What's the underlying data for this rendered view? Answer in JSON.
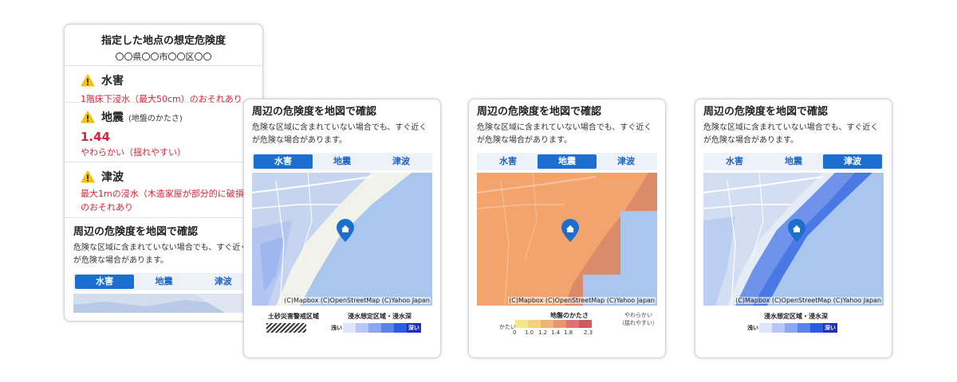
{
  "main_card": {
    "title": "指定した地点の想定危険度",
    "location": "〇〇県〇〇市〇〇区〇〇",
    "hazards": {
      "water": {
        "name": "水害",
        "text": "1階床下浸水（最大50cm）のおそれあり"
      },
      "quake": {
        "name": "地震",
        "sub": "(地盤のかたさ)",
        "value": "1.44",
        "text": "やわらかい（揺れやすい）"
      },
      "tsunami": {
        "name": "津波",
        "text": "最大1mの浸水（木造家屋が部分的に破損）のおそれあり"
      }
    }
  },
  "map_section": {
    "title": "周辺の危険度を地図で確認",
    "description": "危険な区域に含まれていない場合でも、すぐ近くが危険な場合があります。",
    "tabs": [
      "水害",
      "地震",
      "津波"
    ],
    "attribution": "(C)Mapbox (C)OpenStreetMap (C)Yahoo Japan"
  },
  "legend_flood": {
    "landslide_label": "土砂災害警戒区域",
    "depth_title": "浸水想定区域・浸水深",
    "shallow": "浅い",
    "deep": "深い",
    "colors": [
      "#dfe6fb",
      "#b7c8f8",
      "#8aa8f2",
      "#5a82ea",
      "#2c5be0",
      "#1b2fc0"
    ]
  },
  "legend_quake": {
    "title": "地盤のかたさ",
    "hard": "かたい",
    "soft": "やわらかい",
    "soft_note": "（揺れやすい）",
    "ticks": [
      "0",
      "1.0",
      "1.2",
      "1.4",
      "1.8",
      "2.3"
    ],
    "colors": [
      "#f5e88a",
      "#f2d27d",
      "#eeb476",
      "#e9966f",
      "#dd7472",
      "#cf5963"
    ]
  },
  "legend_tsunami": {
    "depth_title": "浸水想定区域・浸水深",
    "shallow": "浅い",
    "deep": "深い",
    "colors": [
      "#dfe6fb",
      "#b7c8f8",
      "#8aa8f2",
      "#5a82ea",
      "#2c5be0",
      "#1b2fc0"
    ]
  },
  "colors": {
    "accent": "#1c6fd1",
    "danger": "#d8243a",
    "warning": "#f7c600"
  }
}
